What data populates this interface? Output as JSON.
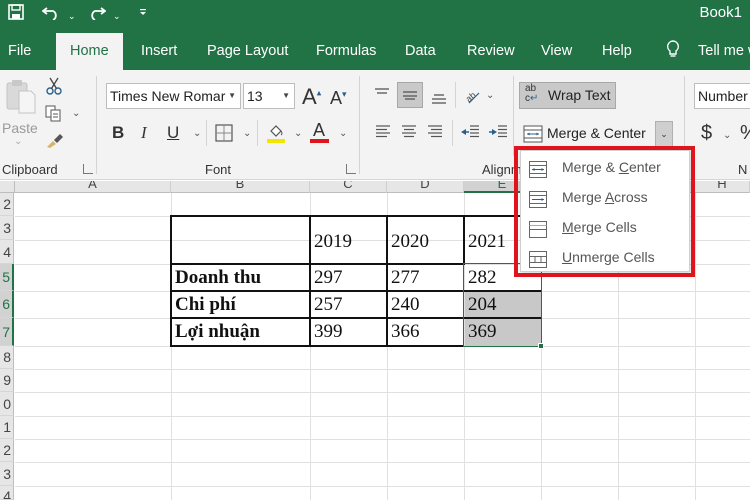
{
  "titlebar": {
    "doc_title": "Book1",
    "qat": [
      {
        "name": "save-icon",
        "glyph": "🖫"
      },
      {
        "name": "undo-icon",
        "glyph": "↶"
      },
      {
        "name": "redo-icon",
        "glyph": "↷"
      },
      {
        "name": "customize-qat-icon",
        "glyph": "▾"
      }
    ]
  },
  "tabs": [
    {
      "label": "File"
    },
    {
      "label": "Home",
      "active": true
    },
    {
      "label": "Insert"
    },
    {
      "label": "Page Layout"
    },
    {
      "label": "Formulas"
    },
    {
      "label": "Data"
    },
    {
      "label": "Review"
    },
    {
      "label": "View"
    },
    {
      "label": "Help"
    },
    {
      "label": "Tell me w"
    }
  ],
  "ribbon": {
    "clipboard": {
      "label": "Clipboard",
      "paste_label": "Paste"
    },
    "font": {
      "label": "Font",
      "font_name": "Times New Romar",
      "font_size": "13",
      "bold": "B",
      "italic": "I",
      "underline": "U",
      "grow": "A",
      "shrink": "A",
      "font_color": "A",
      "fill_color_hex": "#f2e600",
      "font_color_hex": "#e0141c"
    },
    "alignment": {
      "label": "Alignm",
      "wrap_text": "Wrap Text",
      "wrap_icon": "ab c↵",
      "merge_center": "Merge & Center"
    },
    "number": {
      "label": "N",
      "format": "Number",
      "currency": "$",
      "percent": "%"
    }
  },
  "merge_menu": {
    "items": [
      {
        "pre": "Merge & ",
        "key": "C",
        "post": "enter",
        "icon": "merge-center-icon"
      },
      {
        "pre": "Merge ",
        "key": "A",
        "post": "cross",
        "icon": "merge-across-icon"
      },
      {
        "pre": "",
        "key": "M",
        "post": "erge Cells",
        "icon": "merge-cells-icon"
      },
      {
        "pre": "",
        "key": "U",
        "post": "nmerge Cells",
        "icon": "unmerge-cells-icon"
      }
    ]
  },
  "sheet": {
    "columns": [
      "A",
      "B",
      "C",
      "D",
      "E",
      "",
      "H"
    ],
    "rows": [
      "2",
      "3",
      "4",
      "5",
      "6",
      "7",
      "8",
      "9",
      "0",
      "1",
      "2",
      "3",
      "4"
    ],
    "table": {
      "header": [
        "",
        "2019",
        "2020",
        "2021"
      ],
      "rows": [
        {
          "label": "Doanh thu",
          "values": [
            "297",
            "277",
            "282"
          ]
        },
        {
          "label": "Chi phí",
          "values": [
            "257",
            "240",
            "204"
          ]
        },
        {
          "label": "Lợi nhuận",
          "values": [
            "399",
            "366",
            "369"
          ]
        }
      ]
    },
    "selection": "E5:E7",
    "accent_hex": "#217346"
  }
}
